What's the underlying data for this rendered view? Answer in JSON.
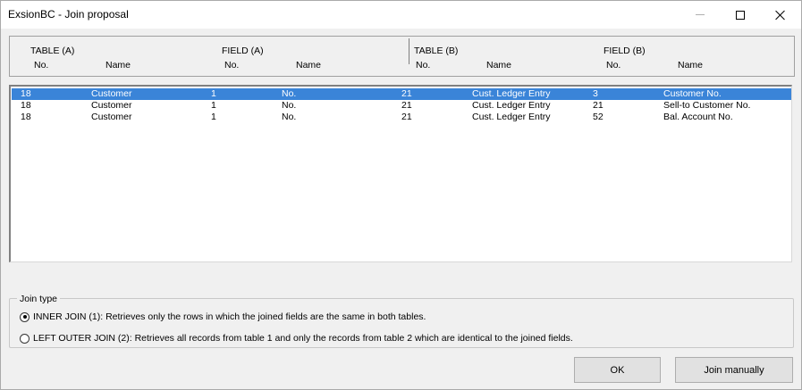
{
  "window": {
    "title": "ExsionBC - Join proposal"
  },
  "header": {
    "table_a": "TABLE (A)",
    "field_a": "FIELD (A)",
    "table_b": "TABLE (B)",
    "field_b": "FIELD (B)",
    "no_label": "No.",
    "name_label": "Name"
  },
  "rows": [
    {
      "table_a_no": "18",
      "table_a_name": "Customer",
      "field_a_no": "1",
      "field_a_name": "No.",
      "table_b_no": "21",
      "table_b_name": "Cust. Ledger Entry",
      "field_b_no": "3",
      "field_b_name": "Customer No.",
      "selected": true
    },
    {
      "table_a_no": "18",
      "table_a_name": "Customer",
      "field_a_no": "1",
      "field_a_name": "No.",
      "table_b_no": "21",
      "table_b_name": "Cust. Ledger Entry",
      "field_b_no": "21",
      "field_b_name": "Sell-to Customer No.",
      "selected": false
    },
    {
      "table_a_no": "18",
      "table_a_name": "Customer",
      "field_a_no": "1",
      "field_a_name": "No.",
      "table_b_no": "21",
      "table_b_name": "Cust. Ledger Entry",
      "field_b_no": "52",
      "field_b_name": "Bal. Account No.",
      "selected": false
    }
  ],
  "join_type": {
    "legend": "Join type",
    "inner": "INNER JOIN (1): Retrieves only the rows in which the joined fields are the same in both tables.",
    "left_outer": "LEFT OUTER JOIN (2): Retrieves all records from table 1 and only the records from table 2 which are identical to the joined fields.",
    "selected": "inner"
  },
  "buttons": {
    "ok": "OK",
    "join_manually": "Join manually"
  },
  "colors": {
    "selection": "#3a84d8"
  }
}
